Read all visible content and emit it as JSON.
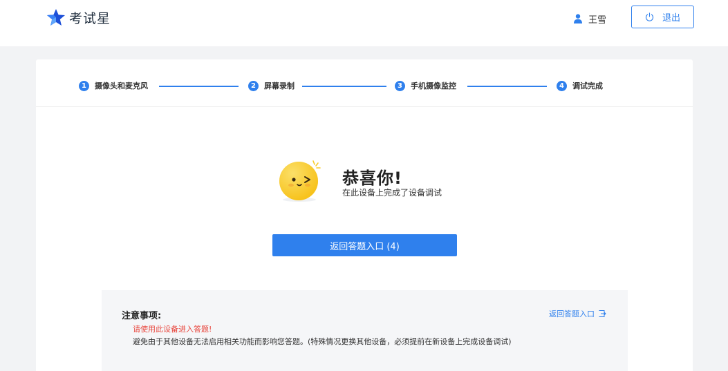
{
  "header": {
    "logo_text": "考试星",
    "user_name": "王雪",
    "logout_label": "退出"
  },
  "steps": [
    {
      "num": "1",
      "label": "摄像头和麦克风"
    },
    {
      "num": "2",
      "label": "屏幕录制"
    },
    {
      "num": "3",
      "label": "手机摄像监控"
    },
    {
      "num": "4",
      "label": "调试完成"
    }
  ],
  "result": {
    "title": "恭喜你!",
    "subtitle": "在此设备上完成了设备调试",
    "return_button": "返回答题入口 (4)"
  },
  "notice": {
    "title": "注意事项:",
    "warning": "请使用此设备进入答题!",
    "description": "避免由于其他设备无法启用相关功能而影响您答题。(特殊情况更换其他设备，必须提前在新设备上完成设备调试)",
    "link": "返回答题入口"
  },
  "colors": {
    "accent": "#2f80ed",
    "warning": "#e8453c",
    "background": "#f2f3f5"
  }
}
